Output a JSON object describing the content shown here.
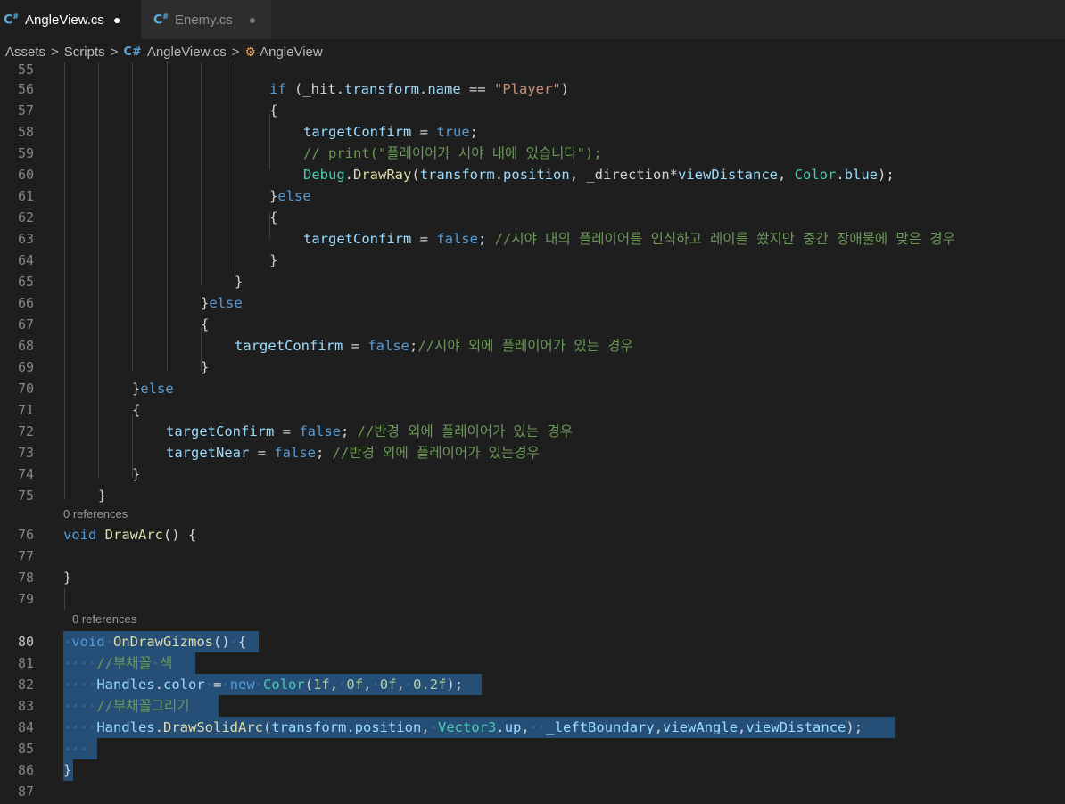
{
  "tabs": [
    {
      "label": "AngleView.cs",
      "icon": "csharp-file-icon",
      "state": "●",
      "active": true
    },
    {
      "label": "Enemy.cs",
      "icon": "csharp-file-icon",
      "state": "●",
      "active": false
    }
  ],
  "breadcrumb": {
    "items": [
      "Assets",
      "Scripts",
      "AngleView.cs",
      "AngleView"
    ],
    "separator": ">"
  },
  "codelens": {
    "draw_arc": "0 references",
    "on_draw_gizmos": "0 references"
  },
  "code_lines": [
    {
      "n": "55",
      "text": ""
    },
    {
      "n": "56",
      "text": "if (_hit.transform.name == \"Player\")"
    },
    {
      "n": "57",
      "text": "{"
    },
    {
      "n": "58",
      "text": "targetConfirm = true;"
    },
    {
      "n": "59",
      "text": "// print(\"플레이어가 시야 내에 있습니다\");"
    },
    {
      "n": "60",
      "text": "Debug.DrawRay(transform.position, _direction*viewDistance, Color.blue);"
    },
    {
      "n": "61",
      "text": "}else"
    },
    {
      "n": "62",
      "text": "{"
    },
    {
      "n": "63",
      "text": "targetConfirm = false; //시야 내의 플레이어를 인식하고 레이를 쐈지만 중간 장애물에 맞은 경우"
    },
    {
      "n": "64",
      "text": "}"
    },
    {
      "n": "65",
      "text": "}"
    },
    {
      "n": "66",
      "text": "}else"
    },
    {
      "n": "67",
      "text": "{"
    },
    {
      "n": "68",
      "text": "targetConfirm = false;//시야 외에 플레이어가 있는 경우"
    },
    {
      "n": "69",
      "text": "}"
    },
    {
      "n": "70",
      "text": "}else"
    },
    {
      "n": "71",
      "text": "{"
    },
    {
      "n": "72",
      "text": "targetConfirm = false; //반경 외에 플레이어가 있는 경우"
    },
    {
      "n": "73",
      "text": "targetNear = false; //반경 외에 플레이어가 있는경우"
    },
    {
      "n": "74",
      "text": "}"
    },
    {
      "n": "75",
      "text": "}"
    },
    {
      "n": "76",
      "text": "void DrawArc() {"
    },
    {
      "n": "77",
      "text": ""
    },
    {
      "n": "78",
      "text": "}"
    },
    {
      "n": "79",
      "text": ""
    },
    {
      "n": "80",
      "text": "void OnDrawGizmos() {"
    },
    {
      "n": "81",
      "text": "//부채꼴 색"
    },
    {
      "n": "82",
      "text": "Handles.color = new Color(1f, 0f, 0f, 0.2f);"
    },
    {
      "n": "83",
      "text": "//부채꼴그리기"
    },
    {
      "n": "84",
      "text": "Handles.DrawSolidArc(transform.position, Vector3.up,  _leftBoundary,viewAngle,viewDistance);"
    },
    {
      "n": "85",
      "text": ""
    },
    {
      "n": "86",
      "text": "}"
    },
    {
      "n": "87",
      "text": ""
    }
  ],
  "colors": {
    "background": "#1e1e1e",
    "selection": "#264f78",
    "keyword": "#569cd6",
    "type": "#4ec9b0",
    "method": "#dcdcaa",
    "variable": "#9cdcfe",
    "string": "#ce9178",
    "comment": "#6a9955",
    "number": "#b5cea8"
  }
}
